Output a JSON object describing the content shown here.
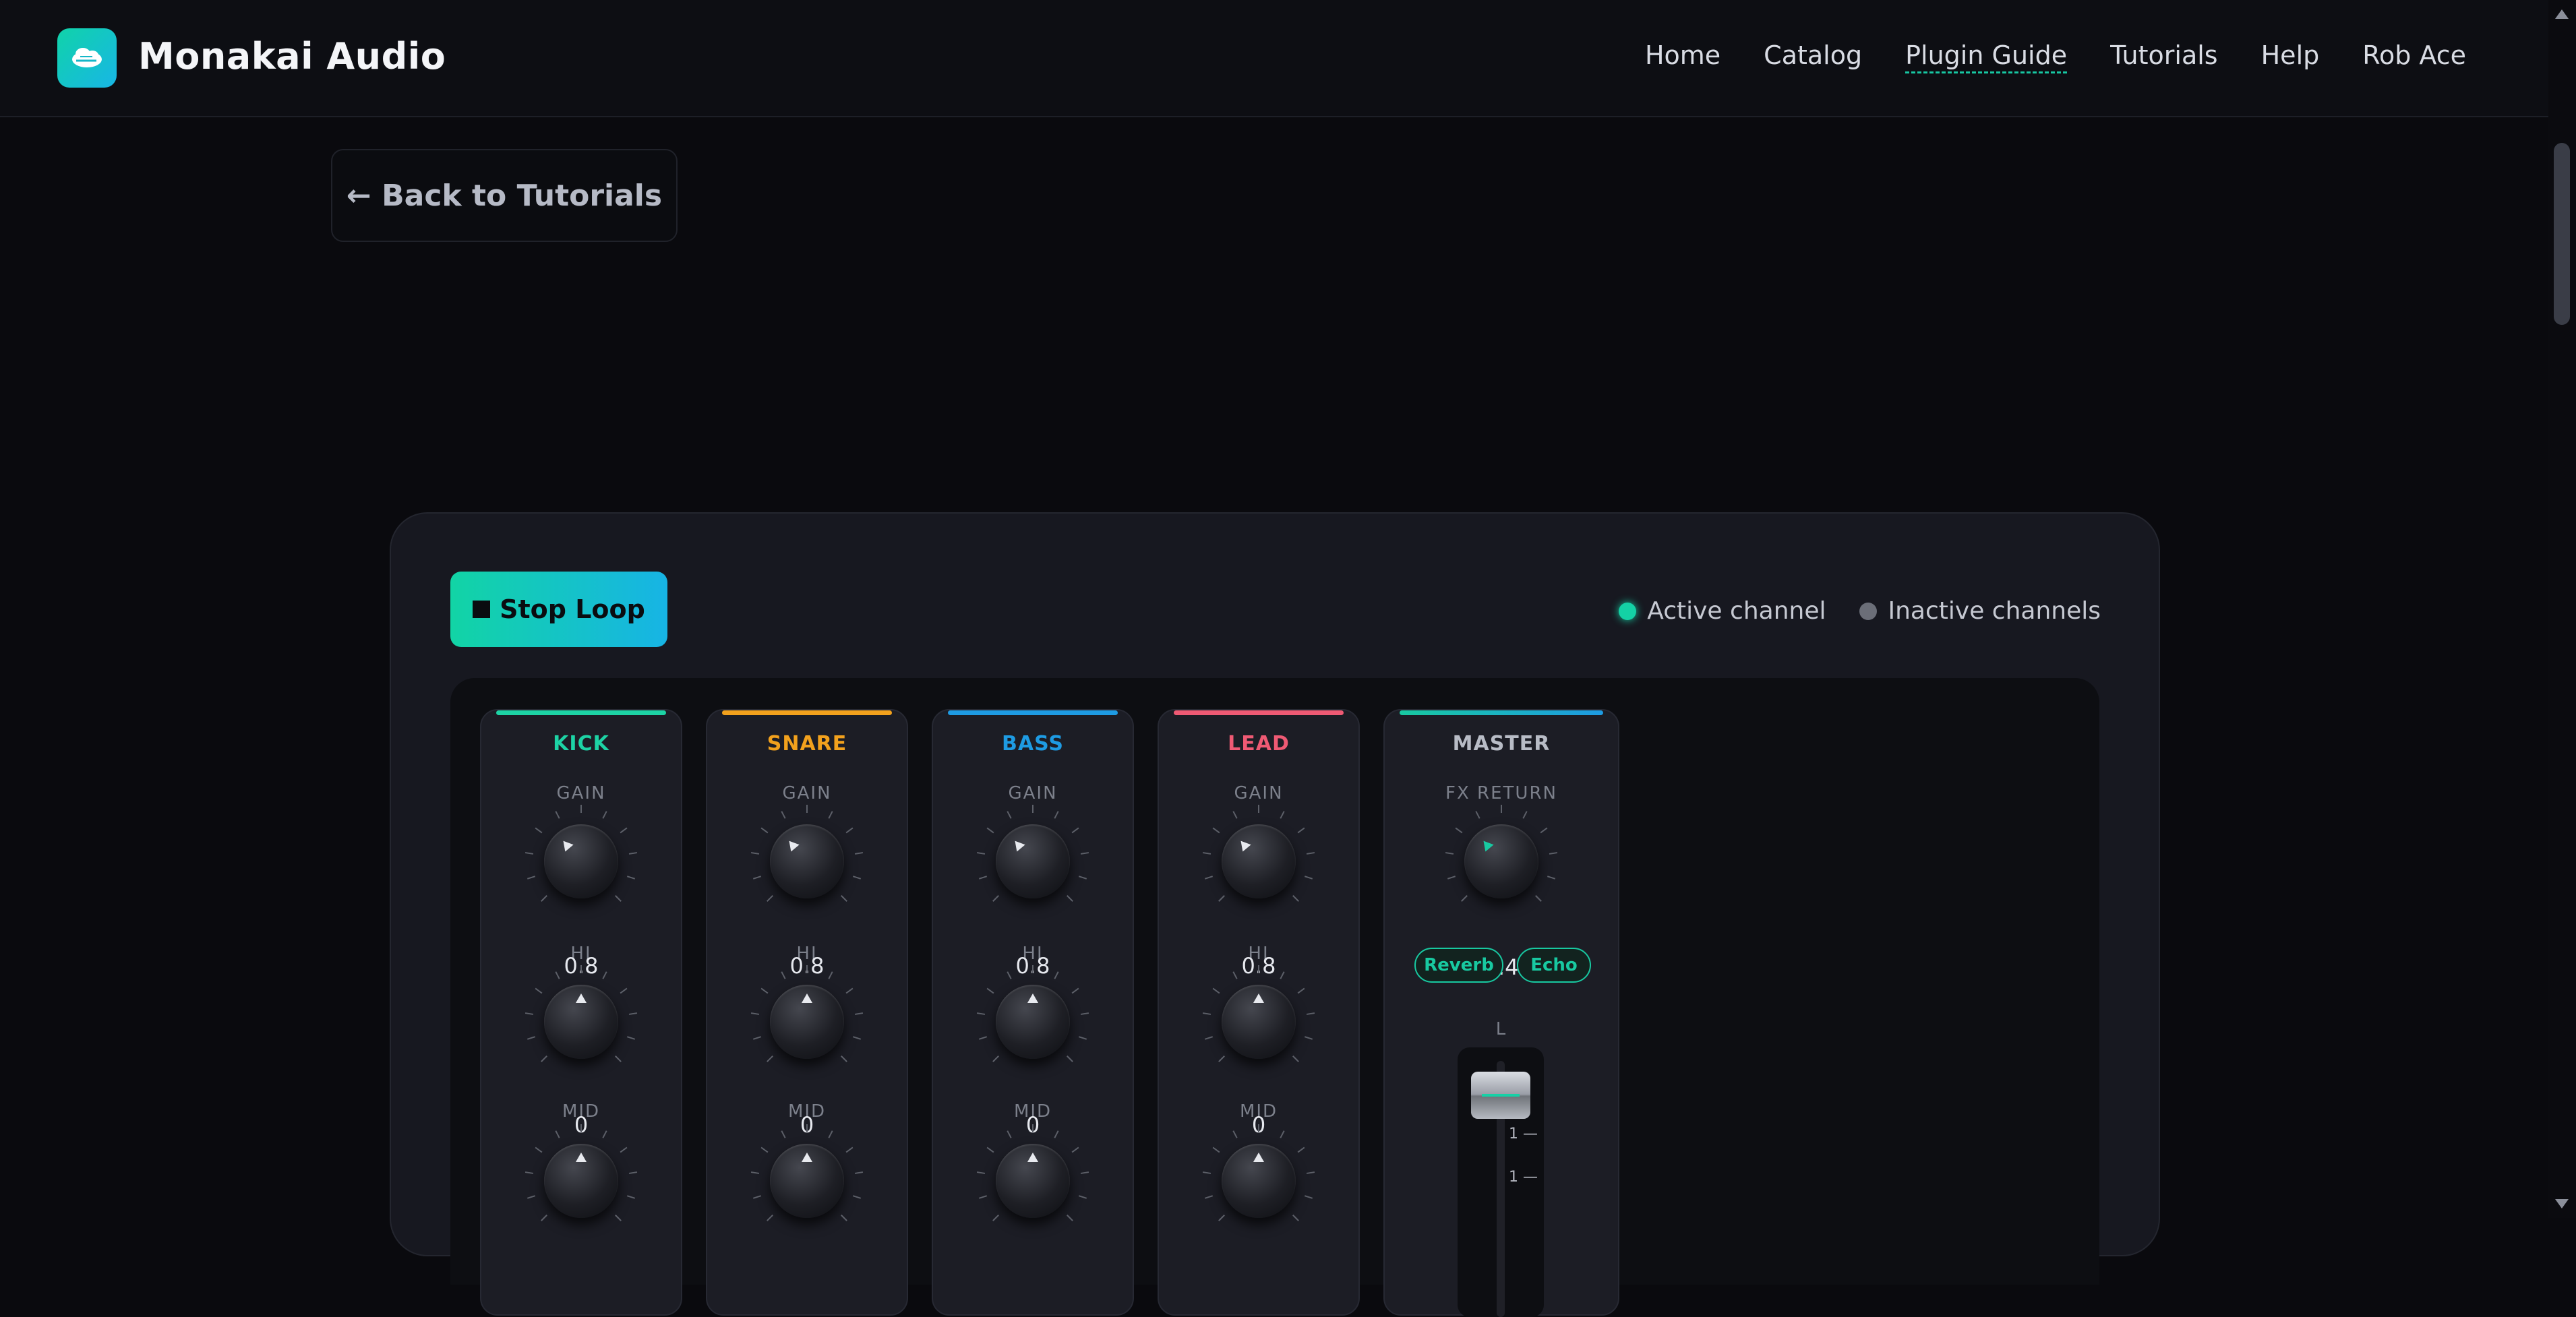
{
  "header": {
    "brand": "Monakai Audio",
    "nav": [
      "Home",
      "Catalog",
      "Plugin Guide",
      "Tutorials",
      "Help",
      "Rob Ace"
    ]
  },
  "back_button": "← Back to Tutorials",
  "controls": {
    "stop_loop": "Stop Loop",
    "legend_active": "Active channel",
    "legend_inactive": "Inactive channels"
  },
  "channels": [
    {
      "name": "KICK",
      "color": "#1dd3a5",
      "gain_label": "GAIN",
      "hi_label": "HI",
      "hi_value": "0.8",
      "mid_label": "MID",
      "mid_value": "0"
    },
    {
      "name": "SNARE",
      "color": "#f2a11d",
      "gain_label": "GAIN",
      "hi_label": "HI",
      "hi_value": "0.8",
      "mid_label": "MID",
      "mid_value": "0"
    },
    {
      "name": "BASS",
      "color": "#1e9be3",
      "gain_label": "GAIN",
      "hi_label": "HI",
      "hi_value": "0.8",
      "mid_label": "MID",
      "mid_value": "0"
    },
    {
      "name": "LEAD",
      "color": "#ef5a74",
      "gain_label": "GAIN",
      "hi_label": "HI",
      "hi_value": "0.8",
      "mid_label": "MID",
      "mid_value": "0"
    }
  ],
  "master": {
    "name": "MASTER",
    "fx_label": "FX RETURN",
    "fx_value": "0.4",
    "reverb": "Reverb",
    "echo": "Echo",
    "fader_label": "L",
    "fader_marks": [
      "1 —",
      "1 —"
    ]
  },
  "colors": {
    "accent": "#14d1a5",
    "master_bar": "#1fb9a8"
  }
}
